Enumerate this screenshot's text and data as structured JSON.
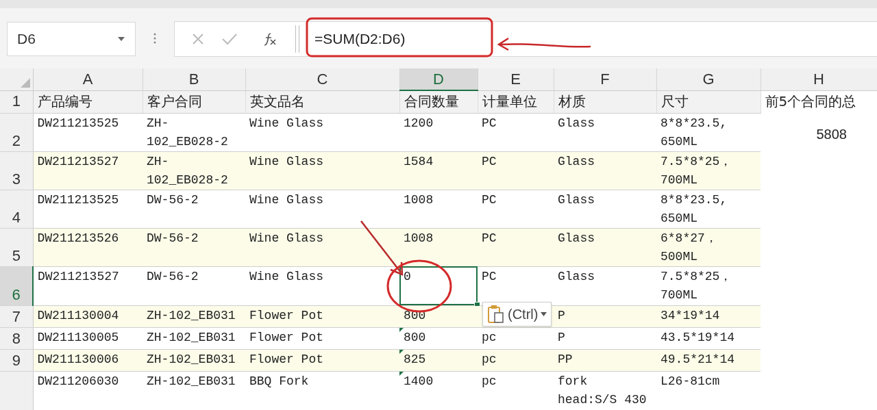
{
  "name_box": {
    "value": "D6"
  },
  "formula_bar": {
    "formula": "=SUM(D2:D6)"
  },
  "columns": [
    {
      "label": "A",
      "selected": false
    },
    {
      "label": "B",
      "selected": false
    },
    {
      "label": "C",
      "selected": false
    },
    {
      "label": "D",
      "selected": true
    },
    {
      "label": "E",
      "selected": false
    },
    {
      "label": "F",
      "selected": false
    },
    {
      "label": "G",
      "selected": false
    },
    {
      "label": "H",
      "selected": false
    }
  ],
  "rows": [
    {
      "number": "1",
      "kind": "header",
      "selected": false,
      "cells": [
        "产品编号",
        "客户合同",
        "英文品名",
        "合同数量",
        "计量单位",
        "材质",
        "尺寸",
        "前5个合同的总"
      ]
    },
    {
      "number": "2",
      "kind": "data",
      "selected": false,
      "shaded": false,
      "flagged": false,
      "cells": [
        "DW211213525",
        "ZH-\n102_EB028-2",
        "Wine Glass",
        "1200",
        "PC",
        "Glass",
        "8*8*23.5,\n650ML",
        "5808"
      ]
    },
    {
      "number": "3",
      "kind": "data",
      "selected": false,
      "shaded": true,
      "flagged": false,
      "cells": [
        "DW211213527",
        "ZH-\n102_EB028-2",
        "Wine Glass",
        "1584",
        "PC",
        "Glass",
        "7.5*8*25，\n700ML"
      ]
    },
    {
      "number": "4",
      "kind": "data",
      "selected": false,
      "shaded": false,
      "flagged": false,
      "cells": [
        "DW211213525",
        "DW-56-2",
        "Wine Glass",
        "1008",
        "PC",
        "Glass",
        "8*8*23.5,\n650ML"
      ]
    },
    {
      "number": "5",
      "kind": "data",
      "selected": false,
      "shaded": true,
      "flagged": false,
      "cells": [
        "DW211213526",
        "DW-56-2",
        "Wine Glass",
        "1008",
        "PC",
        "Glass",
        "6*8*27，\n500ML"
      ]
    },
    {
      "number": "6",
      "kind": "data",
      "selected": true,
      "shaded": false,
      "flagged": false,
      "cells": [
        "DW211213527",
        "DW-56-2",
        "Wine Glass",
        "0",
        "PC",
        "Glass",
        "7.5*8*25，\n700ML"
      ]
    },
    {
      "number": "7",
      "kind": "data",
      "selected": false,
      "shaded": true,
      "flagged": false,
      "cells": [
        "DW211130004",
        "ZH-102_EB031",
        "Flower Pot",
        "800",
        null,
        "P",
        "34*19*14"
      ]
    },
    {
      "number": "8",
      "kind": "data",
      "selected": false,
      "shaded": false,
      "flagged": true,
      "cells": [
        "DW211130005",
        "ZH-102_EB031",
        "Flower Pot",
        "800",
        "pc",
        "P",
        "43.5*19*14"
      ]
    },
    {
      "number": "9",
      "kind": "data",
      "selected": false,
      "shaded": true,
      "flagged": true,
      "cells": [
        "DW211130006",
        "ZH-102_EB031",
        "Flower Pot",
        "825",
        "pc",
        "PP",
        "49.5*21*14"
      ]
    },
    {
      "kind": "data",
      "selected": false,
      "shaded": false,
      "flagged": true,
      "cells": [
        "DW211206030",
        "ZH-102_EB031",
        "BBQ Fork",
        "1400",
        "pc",
        "fork\nhead:S/S 430",
        "L26-81cm"
      ]
    }
  ],
  "paste_options": {
    "label": "(Ctrl)"
  }
}
